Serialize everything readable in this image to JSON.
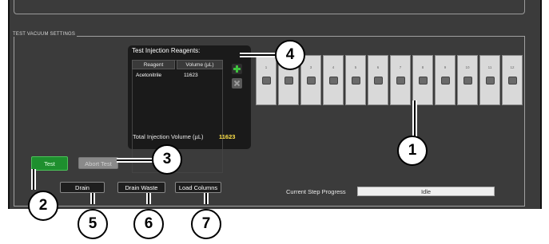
{
  "section_title": "TEST VACUUM SETTINGS",
  "reagents": {
    "title": "Test Injection Reagents:",
    "col_reagent": "Reagent",
    "col_volume": "Volume (µL)",
    "rows": [
      {
        "reagent": "Acetonitrile",
        "volume": "11623"
      }
    ],
    "total_label": "Total Injection Volume (µL)",
    "total_value": "11623",
    "add_icon": "plus-icon",
    "remove_icon": "x-icon"
  },
  "tubes": [
    "1",
    "2",
    "3",
    "4",
    "5",
    "6",
    "7",
    "8",
    "9",
    "10",
    "11",
    "12"
  ],
  "buttons": {
    "test": "Test",
    "abort": "Abort Test",
    "drain": "Drain",
    "drain_waste": "Drain Waste",
    "load_columns": "Load Columns"
  },
  "progress": {
    "label": "Current Step Progress",
    "status": "Idle"
  },
  "callouts": [
    "1",
    "2",
    "3",
    "4",
    "5",
    "6",
    "7"
  ],
  "colors": {
    "panel_bg": "#3b3b3b",
    "test_green": "#1e8f2e",
    "total_yellow": "#ffe34a"
  }
}
